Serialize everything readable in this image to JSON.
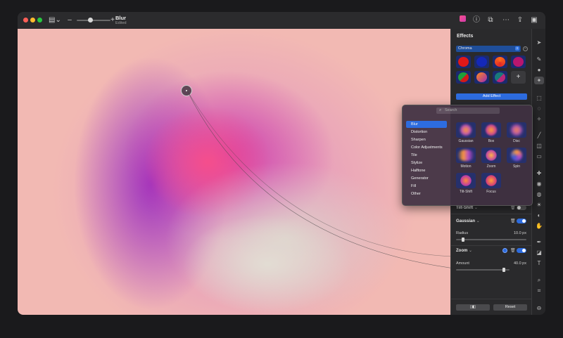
{
  "titlebar": {
    "title": "Blur",
    "subtitle": "Edited",
    "zoom_minus": "–",
    "zoom_plus": "+",
    "icons": [
      "sidebar-toggle-icon",
      "effects-icon",
      "info-icon",
      "share-crop-icon",
      "more-icon",
      "export-icon",
      "inspector-icon"
    ]
  },
  "panel": {
    "heading": "Effects",
    "preset": "Chroma",
    "preset_minus": "–",
    "add_tile": "+",
    "add_effect": "Add Effect",
    "effects": [
      {
        "name": "Tilt-Shift",
        "chevron": "⌄",
        "enabled": false
      },
      {
        "name": "Gaussian",
        "chevron": "⌄",
        "enabled": true,
        "param_label": "Radius",
        "param_value": "10.0 px",
        "param_level": 0.1
      },
      {
        "name": "Zoom",
        "chevron": "⌄",
        "enabled": true,
        "param_label": "Amount",
        "param_value": "40.0 px",
        "param_level": 0.9
      }
    ],
    "compare_label": "▯◧",
    "reset_label": "Reset"
  },
  "popup": {
    "search_placeholder": "Search",
    "categories": [
      "Blur",
      "Distortion",
      "Sharpen",
      "Color Adjustments",
      "Tile",
      "Stylize",
      "Halftone",
      "Generator",
      "Fill",
      "Other"
    ],
    "selected_category": "Blur",
    "thumbnails": [
      "Gaussian",
      "Box",
      "Disc",
      "Motion",
      "Zoom",
      "Spin",
      "Tilt-Shift",
      "Focus"
    ]
  },
  "colors": {
    "accent": "#2d6cdf",
    "canvas_bg": "#f2b9b3",
    "magenta": "#d23cae",
    "pink": "#f54e8c",
    "purple": "#9628be",
    "cream": "#e2ded4"
  }
}
